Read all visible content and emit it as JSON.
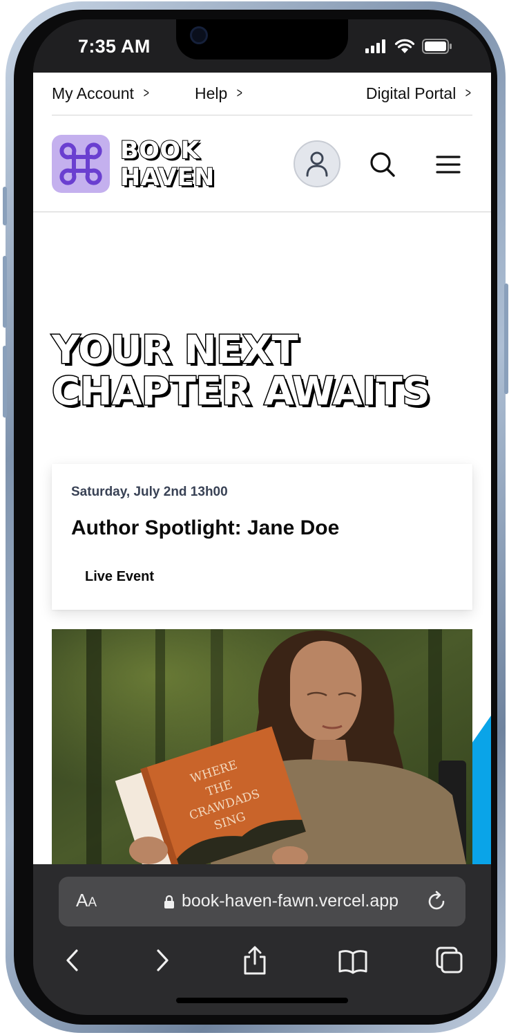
{
  "status_bar": {
    "time": "7:35 AM"
  },
  "top_nav": {
    "links": [
      {
        "label": "My Account"
      },
      {
        "label": "Help"
      },
      {
        "label": "Digital Portal"
      }
    ]
  },
  "header": {
    "logo_line1": "BOOK",
    "logo_line2": "HAVEN",
    "icons": [
      "command-logo-icon",
      "user-icon",
      "search-icon",
      "menu-icon"
    ]
  },
  "hero": {
    "line1": "YOUR NEXT",
    "line2": "CHAPTER AWAITS"
  },
  "event": {
    "date": "Saturday, July 2nd 13h00",
    "title": "Author Spotlight: Jane Doe",
    "tag": "Live Event"
  },
  "hero_image": {
    "book_title_lines": [
      "WHERE",
      "THE",
      "CRAWDADS",
      "SING"
    ]
  },
  "browser": {
    "aa_big": "A",
    "aa_small": "A",
    "url": "book-haven-fawn.vercel.app"
  },
  "colors": {
    "logo_bg": "#c4b0ee",
    "logo_mark": "#6a3fd0",
    "accent_blue": "#0aa4e8",
    "browser_bar": "#2b2b2d"
  }
}
